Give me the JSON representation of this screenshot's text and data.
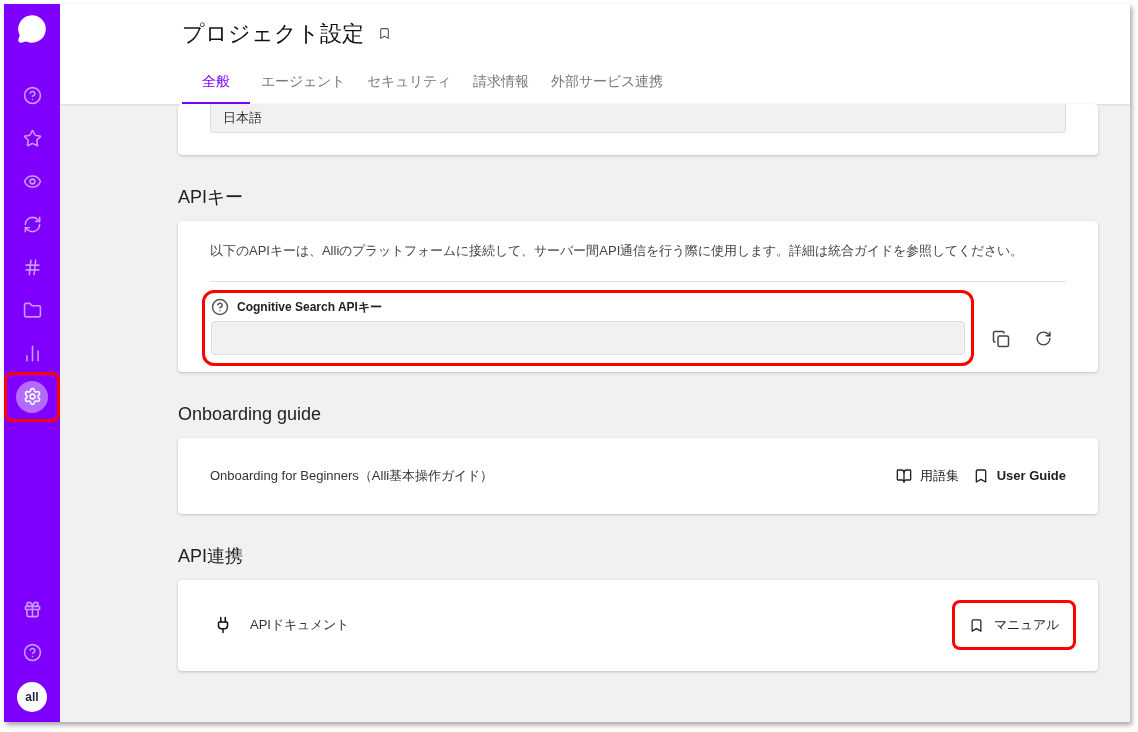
{
  "sidebar": {
    "items": [
      {
        "kind": "help",
        "selected": false,
        "highlighted": false
      },
      {
        "kind": "star",
        "selected": false,
        "highlighted": false
      },
      {
        "kind": "eye",
        "selected": false,
        "highlighted": false
      },
      {
        "kind": "cycle",
        "selected": false,
        "highlighted": false
      },
      {
        "kind": "hash",
        "selected": false,
        "highlighted": false
      },
      {
        "kind": "folder",
        "selected": false,
        "highlighted": false
      },
      {
        "kind": "chart",
        "selected": false,
        "highlighted": false
      },
      {
        "kind": "settings",
        "selected": true,
        "highlighted": true
      }
    ],
    "bottom_items": [
      {
        "kind": "gift",
        "selected": false,
        "highlighted": false
      },
      {
        "kind": "help",
        "selected": false,
        "highlighted": false
      }
    ],
    "avatar": "all"
  },
  "header": {
    "title": "プロジェクト設定",
    "tabs": [
      {
        "label": "全般",
        "selected": true
      },
      {
        "label": "エージェント",
        "selected": false
      },
      {
        "label": "セキュリティ",
        "selected": false
      },
      {
        "label": "請求情報",
        "selected": false
      },
      {
        "label": "外部サービス連携",
        "selected": false
      }
    ]
  },
  "language_field": {
    "value": "日本語"
  },
  "api_key": {
    "heading": "APIキー",
    "description": "以下のAPIキーは、Alliのプラットフォームに接続して、サーバー間API通信を行う際に使用します。詳細は統合ガイドを参照してください。",
    "field_label": "Cognitive Search APIキー",
    "highlighted": true
  },
  "onboarding": {
    "heading": "Onboarding guide",
    "item": "Onboarding for Beginners（Alli基本操作ガイド）",
    "links": [
      {
        "kind": "glossary",
        "label": "用語集",
        "bold": false
      },
      {
        "kind": "guide",
        "label": "User Guide",
        "bold": true
      }
    ]
  },
  "api_integration": {
    "heading": "API連携",
    "item": "APIドキュメント",
    "link": {
      "label": "マニュアル",
      "highlighted": true
    }
  }
}
